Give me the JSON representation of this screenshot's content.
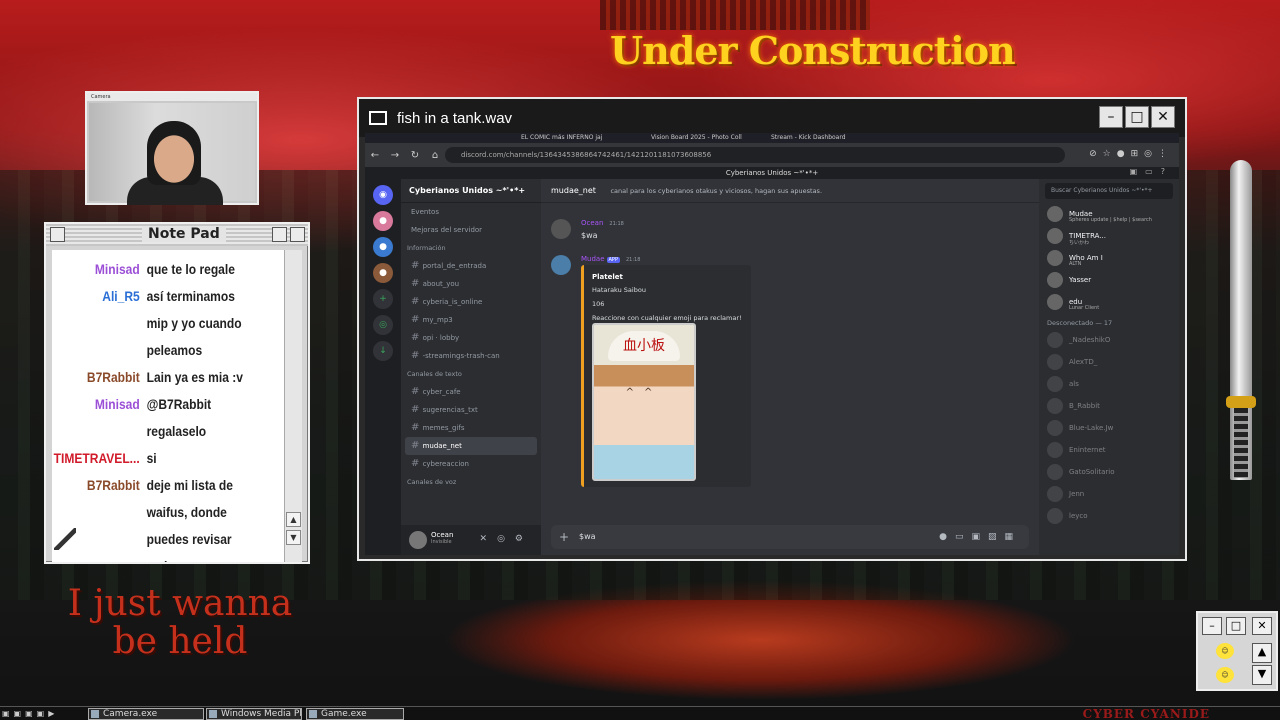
{
  "overlay": {
    "banner": "Under Construction",
    "wordart": [
      "I just wanna",
      "be held"
    ]
  },
  "camera": {
    "caption": "Camera"
  },
  "notepad": {
    "title": "Note Pad",
    "chat": [
      {
        "user": "Minisad",
        "color": "#9b4fd6",
        "text": "que te lo regale"
      },
      {
        "user": "Ali_R5",
        "color": "#2b6fd6",
        "text": "así terminamos mip y yo cuando peleamos"
      },
      {
        "user": "B7Rabbit",
        "color": "#8a4a2a",
        "text": "Lain ya es mia :v"
      },
      {
        "user": "Minisad",
        "color": "#9b4fd6",
        "text": "@B7Rabbit regalaselo"
      },
      {
        "user": "TIMETRAVEL...",
        "color": "#d11a2a",
        "text": "si"
      },
      {
        "user": "B7Rabbit",
        "color": "#8a4a2a",
        "text": "deje mi lista de waifus, donde puedes revisar cada una :v"
      }
    ]
  },
  "window": {
    "title": "fish in a tank.wav"
  },
  "browser": {
    "tabs": [
      "EL COMIC más INFERNO jaj",
      "Vision Board 2025 - Photo Coll",
      "Stream - Kick Dashboard"
    ],
    "url": "discord.com/channels/1364345386864742461/1421201181073608856"
  },
  "discord": {
    "window_title": "Cyberianos Unidos ~*'•*+",
    "server_name": "Cyberianos Unidos ~*'•*+",
    "nav": [
      "Eventos",
      "Mejoras del servidor"
    ],
    "categories": [
      {
        "name": "Información",
        "channels": [
          "portal_de_entrada",
          "about_you",
          "cyberia_is_online",
          "my_mp3",
          "opi · lobby",
          "-streamings-trash-can"
        ]
      },
      {
        "name": "Canales de texto",
        "channels": [
          "cyber_cafe",
          "sugerencias_txt",
          "memes_gifs",
          "mudae_net",
          "cybereaccion"
        ]
      },
      {
        "name": "Canales de voz",
        "channels": []
      }
    ],
    "active_channel": "mudae_net",
    "topic": "canal para los cyberianos otakus y viciosos, hagan sus apuestas.",
    "messages": [
      {
        "author": "Ocean",
        "time": "21:18",
        "text": "$wa"
      },
      {
        "author": "Mudae",
        "badge": "APP",
        "time": "21:18",
        "embed": {
          "title": "Platelet",
          "series": "Hataraku Saibou",
          "value": "106",
          "hint": "Reaccione con cualquier emoji para reclamar!"
        }
      }
    ],
    "input_value": "$wa",
    "user": {
      "name": "Ocean",
      "status": "Invisible"
    },
    "search_placeholder": "Buscar Cyberianos Unidos ~*'•*+",
    "members_online": [
      {
        "name": "Mudae",
        "sub": "Spheres update | $help | $search"
      },
      {
        "name": "TIMETRA...",
        "sub": "ちいかわ"
      },
      {
        "name": "Who Am I",
        "sub": "ALTN"
      },
      {
        "name": "Yasser",
        "sub": ""
      },
      {
        "name": "edu",
        "sub": "Lunar Client"
      }
    ],
    "offline_header": "Desconectado — 17",
    "members_offline": [
      "_NadeshikO",
      "AlexTD_",
      "als",
      "B_Rabbit",
      "Blue-Lake.Jw",
      "Eninternet",
      "GatoSolitario",
      "Jenn",
      "leyco"
    ]
  },
  "taskbar": {
    "items": [
      "Camera.exe",
      "Windows Media Pla",
      "Game.exe"
    ],
    "tray_text": "CYBER CYANIDE"
  }
}
